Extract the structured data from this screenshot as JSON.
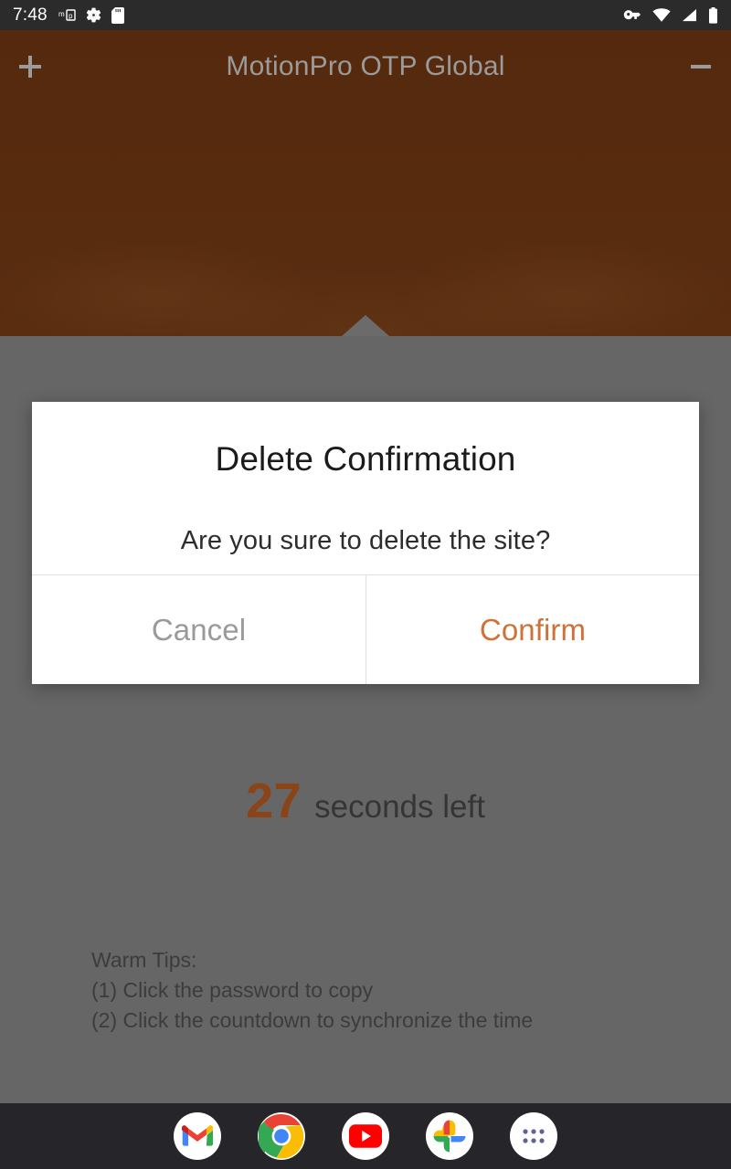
{
  "status_bar": {
    "clock": "7:48",
    "left_icons": [
      "mp-badge-icon",
      "gear-icon",
      "sd-card-icon"
    ],
    "right_icons": [
      "vpn-key-icon",
      "wifi-icon",
      "cellular-signal-icon",
      "battery-icon"
    ],
    "background_color": "#2b2b2b"
  },
  "app": {
    "title": "MotionPro OTP Global",
    "add_label": "+",
    "minimize_label": "−",
    "background_color": "#5c2f12",
    "title_color": "#9b9b9b"
  },
  "countdown": {
    "seconds": "27",
    "label": "seconds left",
    "number_color": "#8a4418"
  },
  "warm_tips": {
    "heading": "Warm Tips:",
    "lines": [
      "(1) Click the password to copy",
      "(2) Click the countdown to synchronize the time"
    ]
  },
  "dialog": {
    "title": "Delete Confirmation",
    "message": "Are you sure to delete the site?",
    "cancel_label": "Cancel",
    "confirm_label": "Confirm",
    "cancel_color": "#9a9a9a",
    "confirm_color": "#cf7238",
    "scrim_color": "#666666"
  },
  "dock": {
    "items": [
      {
        "name": "gmail",
        "label": "Gmail"
      },
      {
        "name": "chrome",
        "label": "Chrome"
      },
      {
        "name": "youtube",
        "label": "YouTube"
      },
      {
        "name": "photos",
        "label": "Photos"
      },
      {
        "name": "app-drawer",
        "label": "All apps"
      }
    ],
    "background_color": "#25252a"
  }
}
